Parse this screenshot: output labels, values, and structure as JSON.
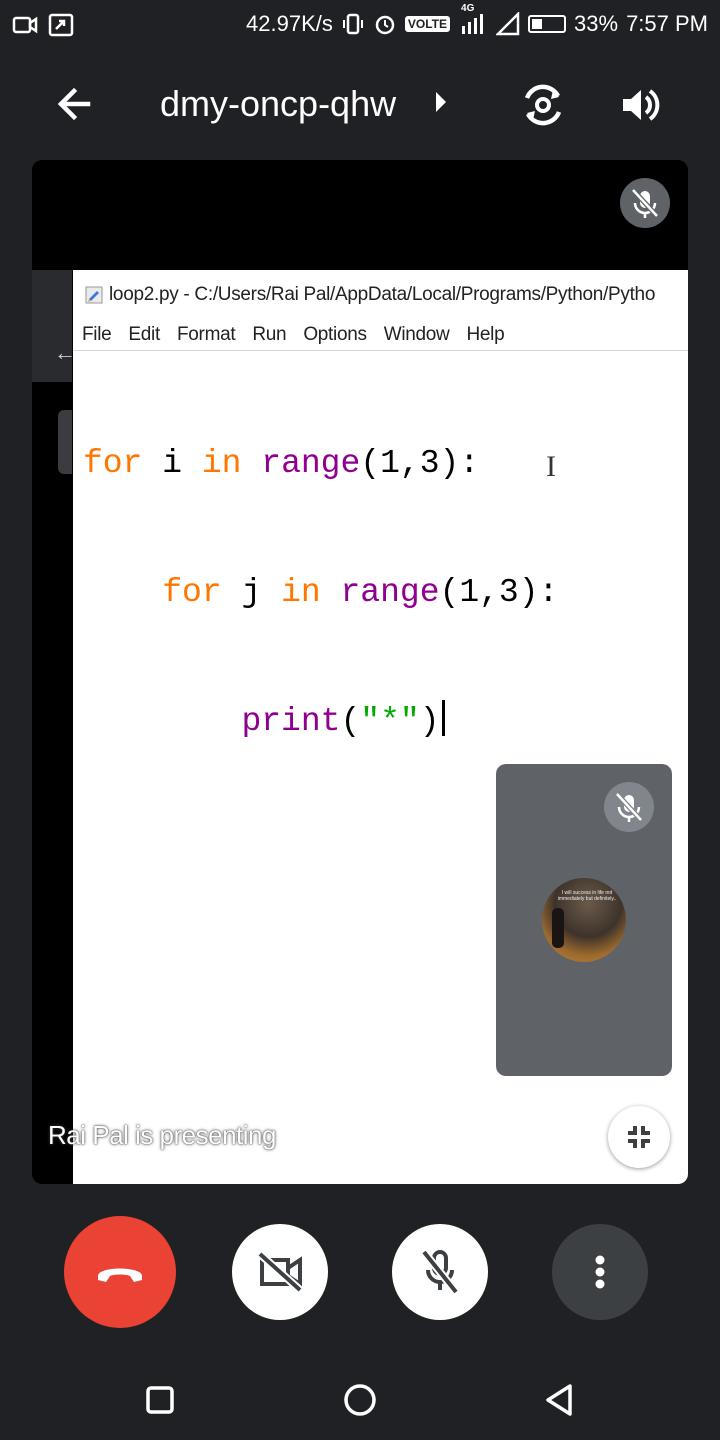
{
  "status_bar": {
    "net_speed": "42.97K/s",
    "network_badge": "VOLTE",
    "network_gen": "4G",
    "battery_percent": "33%",
    "battery_level": 0.33,
    "time": "7:57 PM",
    "icons": [
      "camera-notification-icon",
      "screenshot-notification-icon",
      "vibrate-icon",
      "alarm-icon",
      "signal-icon",
      "battery-icon"
    ]
  },
  "header": {
    "meeting_code": "dmy-oncp-qhw"
  },
  "idle_window": {
    "title": "loop2.py - C:/Users/Rai Pal/AppData/Local/Programs/Python/Pytho",
    "menu": [
      "File",
      "Edit",
      "Format",
      "Run",
      "Options",
      "Window",
      "Help"
    ],
    "code": {
      "line1": {
        "kw1": "for",
        "var": " i ",
        "kw2": "in",
        "fn": "range",
        "args": "(1,3):"
      },
      "line2": {
        "indent": "    ",
        "kw1": "for",
        "var": " j ",
        "kw2": "in",
        "fn": "range",
        "args": "(1,3):"
      },
      "line3": {
        "indent": "        ",
        "fn": "print",
        "open": "(",
        "str": "\"*\"",
        "close": ")"
      }
    }
  },
  "presenting_label": "Rai Pal is presenting",
  "self_tile": {
    "avatar_caption": "I will success in life not immediately but definitely.."
  },
  "colors": {
    "end_call": "#ea4335",
    "keyword": "#ff7700",
    "builtin": "#900090",
    "string": "#00aa00",
    "background": "#202124"
  }
}
